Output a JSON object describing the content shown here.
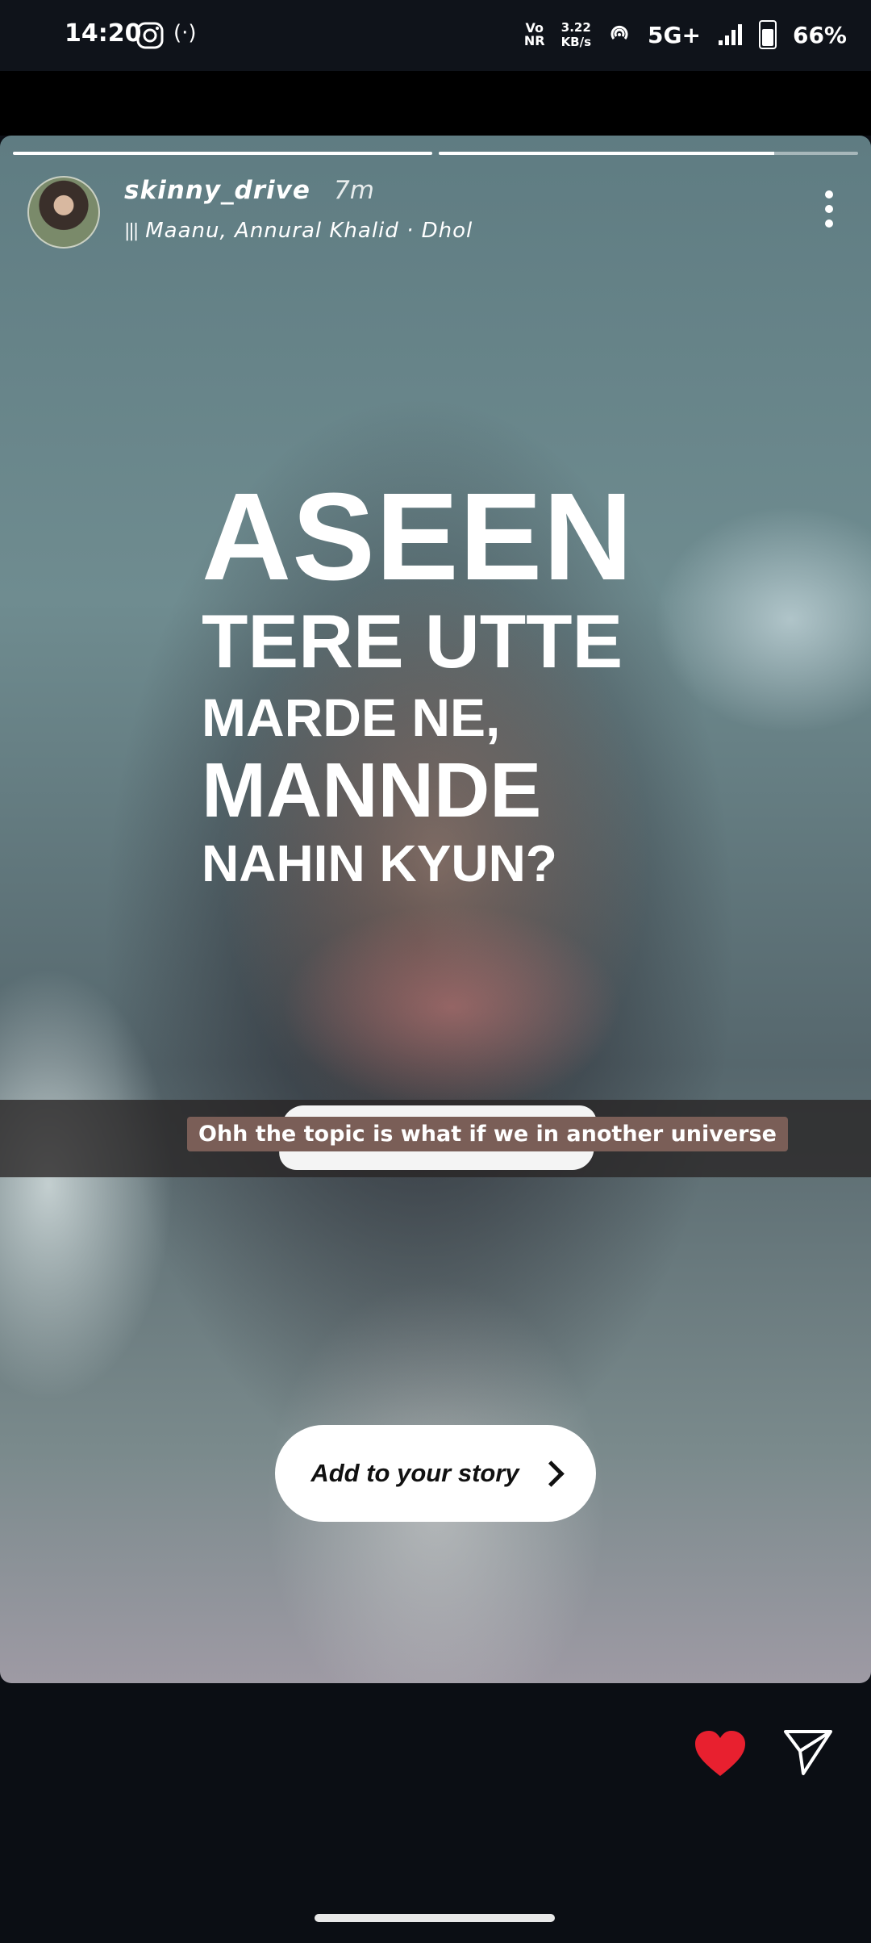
{
  "status_bar": {
    "time": "14:20",
    "network_type_top": "Vo",
    "network_type_bottom": "NR",
    "data_speed_value": "3.22",
    "data_speed_unit": "KB/s",
    "signal": "5G+",
    "battery": "66%",
    "icons": [
      "instagram-icon",
      "radio-icon",
      "hotspot-icon",
      "signal-bars-icon",
      "battery-icon"
    ]
  },
  "story": {
    "progress": [
      1.0,
      0.8
    ],
    "username": "skinny_drive",
    "time_ago": "7m",
    "music": "Maanu, Annural Khalid · Dhol",
    "lyrics": {
      "line1": "ASEEN",
      "line2": "TERE UTTE",
      "line3": "MARDE NE,",
      "line4": "MANNDE",
      "line5": "NAHIN KYUN?"
    },
    "caption": "Ohh the topic is what if we in another universe",
    "add_story_label": "Add to your story"
  },
  "actions": {
    "like_color": "#e8202f",
    "icons": [
      "heart-icon",
      "send-icon"
    ]
  },
  "colors": {
    "background": "#0b0e14",
    "caption_bg": "#7a5e57"
  }
}
